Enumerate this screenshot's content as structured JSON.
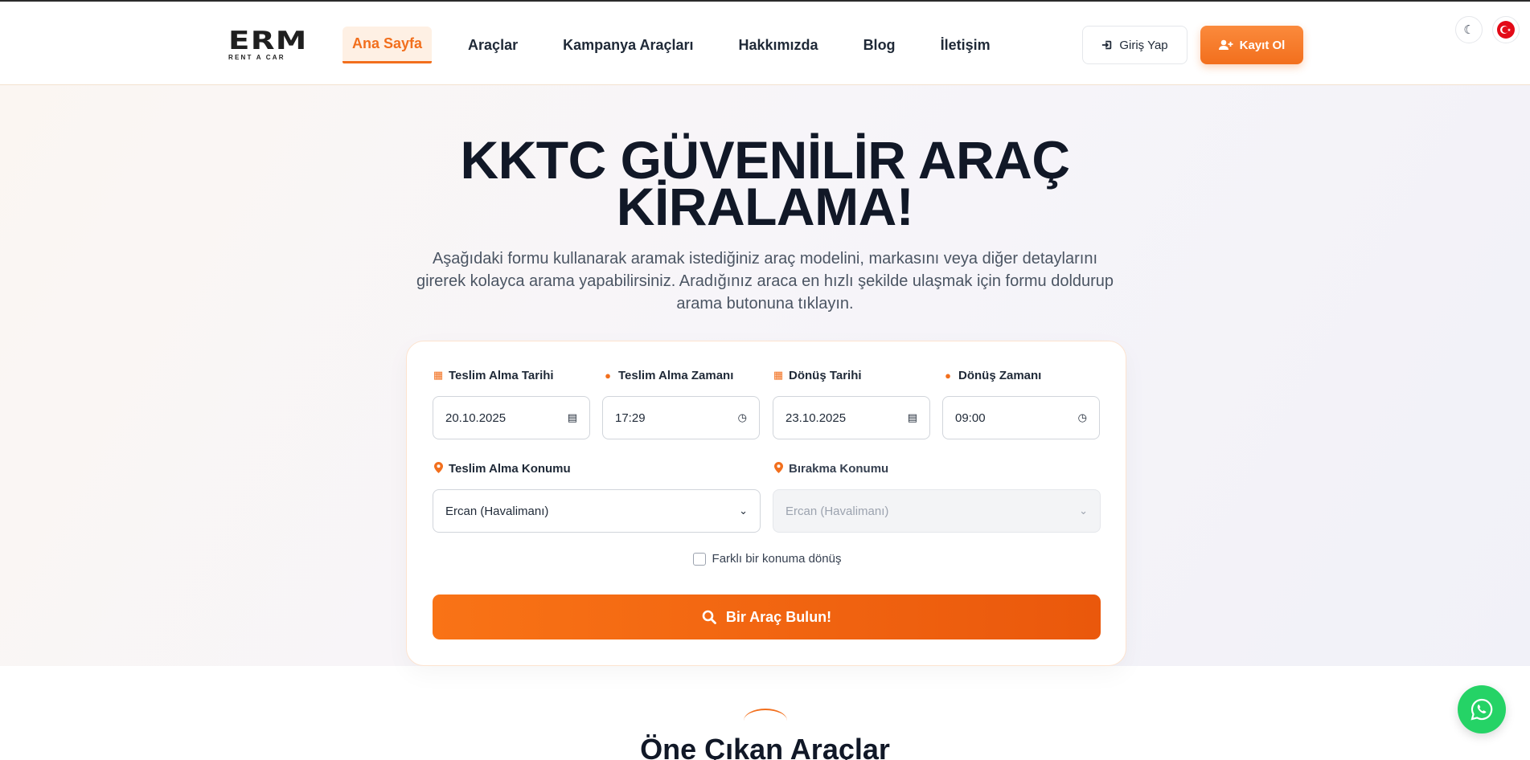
{
  "brand": {
    "logo_main": "ERM",
    "logo_sub": "RENT A CAR"
  },
  "nav": {
    "items": [
      {
        "label": "Ana Sayfa",
        "active": true
      },
      {
        "label": "Araçlar"
      },
      {
        "label": "Kampanya Araçları"
      },
      {
        "label": "Hakkımızda"
      },
      {
        "label": "Blog"
      },
      {
        "label": "İletişim"
      }
    ]
  },
  "auth": {
    "login_label": "Giriş Yap",
    "register_label": "Kayıt Ol"
  },
  "hero": {
    "title_line1": "KKTC GÜVENİLİR ARAÇ",
    "title_line2": "KİRALAMA!",
    "description": "Aşağıdaki formu kullanarak aramak istediğiniz araç modelini, markasını veya diğer detaylarını girerek kolayca arama yapabilirsiniz. Aradığınız araca en hızlı şekilde ulaşmak için formu doldurup arama butonuna tıklayın."
  },
  "search": {
    "pickup_date": {
      "label": "Teslim Alma Tarihi",
      "value": "20.10.2025"
    },
    "pickup_time": {
      "label": "Teslim Alma Zamanı",
      "value": "17:29"
    },
    "return_date": {
      "label": "Dönüş Tarihi",
      "value": "23.10.2025"
    },
    "return_time": {
      "label": "Dönüş Zamanı",
      "value": "09:00"
    },
    "pickup_location": {
      "label": "Teslim Alma Konumu",
      "value": "Ercan (Havalimanı)"
    },
    "dropoff_location": {
      "label": "Bırakma Konumu",
      "value": "Ercan (Havalimanı)",
      "disabled": true
    },
    "different_return_label": "Farklı bir konuma dönüş",
    "different_return_checked": false,
    "submit_label": "Bir Araç Bulun!"
  },
  "featured": {
    "title": "Öne Çıkan Araçlar"
  },
  "colors": {
    "accent": "#f26f1d",
    "whatsapp": "#25d366",
    "heading": "#111827"
  }
}
